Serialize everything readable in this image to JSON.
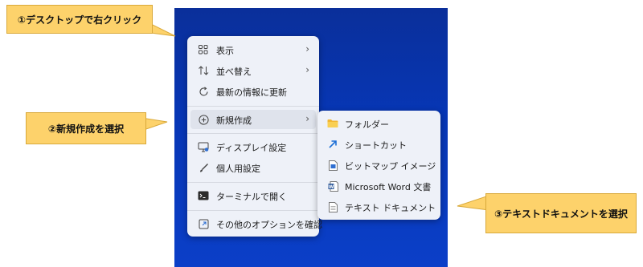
{
  "callouts": {
    "step1": "①デスクトップで右クリック",
    "step2": "②新規作成を選択",
    "step3": "③テキストドキュメントを選択"
  },
  "context_menu": {
    "items": [
      {
        "label": "表示",
        "icon": "grid-icon",
        "has_submenu": true
      },
      {
        "label": "並べ替え",
        "icon": "sort-icon",
        "has_submenu": true
      },
      {
        "label": "最新の情報に更新",
        "icon": "refresh-icon",
        "has_submenu": false
      },
      {
        "label": "新規作成",
        "icon": "plus-circle-icon",
        "has_submenu": true,
        "highlighted": true
      },
      {
        "label": "ディスプレイ設定",
        "icon": "display-icon",
        "has_submenu": false
      },
      {
        "label": "個人用設定",
        "icon": "brush-icon",
        "has_submenu": false
      },
      {
        "label": "ターミナルで開く",
        "icon": "terminal-icon",
        "has_submenu": false
      },
      {
        "label": "その他のオプションを確認",
        "icon": "expand-icon",
        "has_submenu": false
      }
    ]
  },
  "new_submenu": {
    "items": [
      {
        "label": "フォルダー",
        "icon": "folder-icon"
      },
      {
        "label": "ショートカット",
        "icon": "shortcut-icon"
      },
      {
        "label": "ビットマップ イメージ",
        "icon": "bitmap-icon"
      },
      {
        "label": "Microsoft Word 文書",
        "icon": "word-icon"
      },
      {
        "label": "テキスト ドキュメント",
        "icon": "text-document-icon"
      }
    ]
  },
  "colors": {
    "desktop": "#0736b4",
    "callout_fill": "#fdd26b",
    "menu_bg": "#eef1f8"
  }
}
